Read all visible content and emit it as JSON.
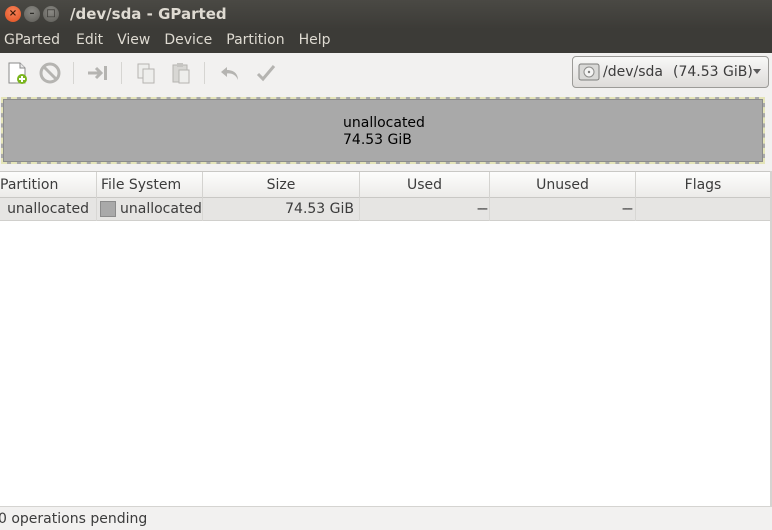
{
  "window": {
    "title": "/dev/sda - GParted",
    "close_glyph": "×",
    "min_glyph": "–",
    "max_glyph": "□"
  },
  "menubar": {
    "items": [
      "GParted",
      "Edit",
      "View",
      "Device",
      "Partition",
      "Help"
    ]
  },
  "toolbar": {
    "icons": [
      "new-partition-icon",
      "delete-icon",
      "resize-move-icon",
      "copy-icon",
      "paste-icon",
      "undo-icon",
      "apply-icon"
    ]
  },
  "device_selector": {
    "device": "/dev/sda",
    "size": "(74.53 GiB)",
    "icon": "hard-disk-icon"
  },
  "disk_map": {
    "label": "unallocated",
    "size": "74.53 GiB",
    "color": "#a9a9a9"
  },
  "table": {
    "columns": [
      "Partition",
      "File System",
      "Size",
      "Used",
      "Unused",
      "Flags"
    ],
    "rows": [
      {
        "partition": "unallocated",
        "file_system": "unallocated",
        "size": "74.53 GiB",
        "used": "---",
        "unused": "---",
        "flags": ""
      }
    ]
  },
  "statusbar": {
    "text": "0 operations pending"
  }
}
